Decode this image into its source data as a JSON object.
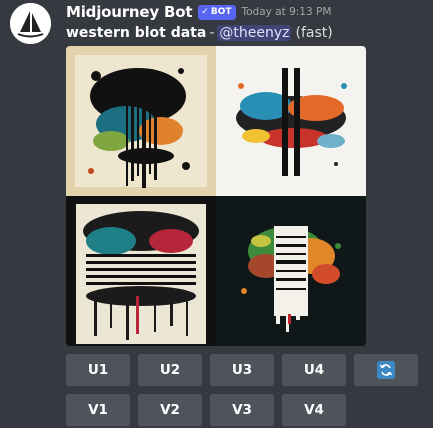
{
  "author": {
    "name": "Midjourney Bot",
    "tag": "BOT",
    "timestamp": "Today at 9:13 PM"
  },
  "message": {
    "prompt": "western blot data",
    "separator": "-",
    "mention": "@theenyz",
    "speed": "(fast)"
  },
  "image": {
    "quadrants": [
      "quadrant-1",
      "quadrant-2",
      "quadrant-3",
      "quadrant-4"
    ]
  },
  "buttons": {
    "upscale": [
      "U1",
      "U2",
      "U3",
      "U4"
    ],
    "variation": [
      "V1",
      "V2",
      "V3",
      "V4"
    ],
    "reroll_icon": "reroll-icon"
  },
  "colors": {
    "background": "#36393f",
    "button": "#4f545c",
    "bot_tag": "#5865f2",
    "mention_bg": "#414675",
    "reroll_accent": "#3b88c3"
  }
}
